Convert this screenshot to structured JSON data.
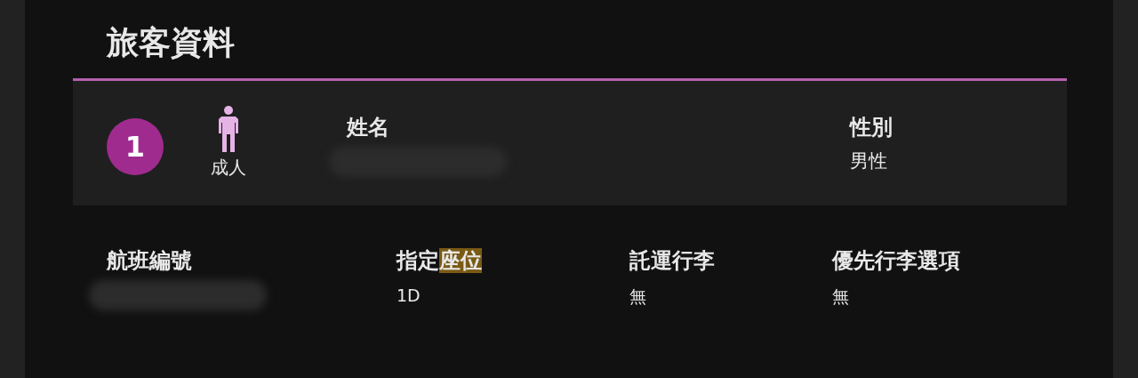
{
  "title": "旅客資料",
  "passenger": {
    "number": "1",
    "type_label": "成人",
    "fields": [
      {
        "label": "姓名",
        "value_hidden": true
      },
      {
        "label": "性別",
        "value": "男性"
      }
    ]
  },
  "details": [
    {
      "label": "航班編號",
      "value_hidden": true
    },
    {
      "label": "指定",
      "highlight": "座位",
      "value": "1D"
    },
    {
      "label": "託運行李",
      "value": "無"
    },
    {
      "label": "優先行李選項",
      "value": "無"
    }
  ]
}
